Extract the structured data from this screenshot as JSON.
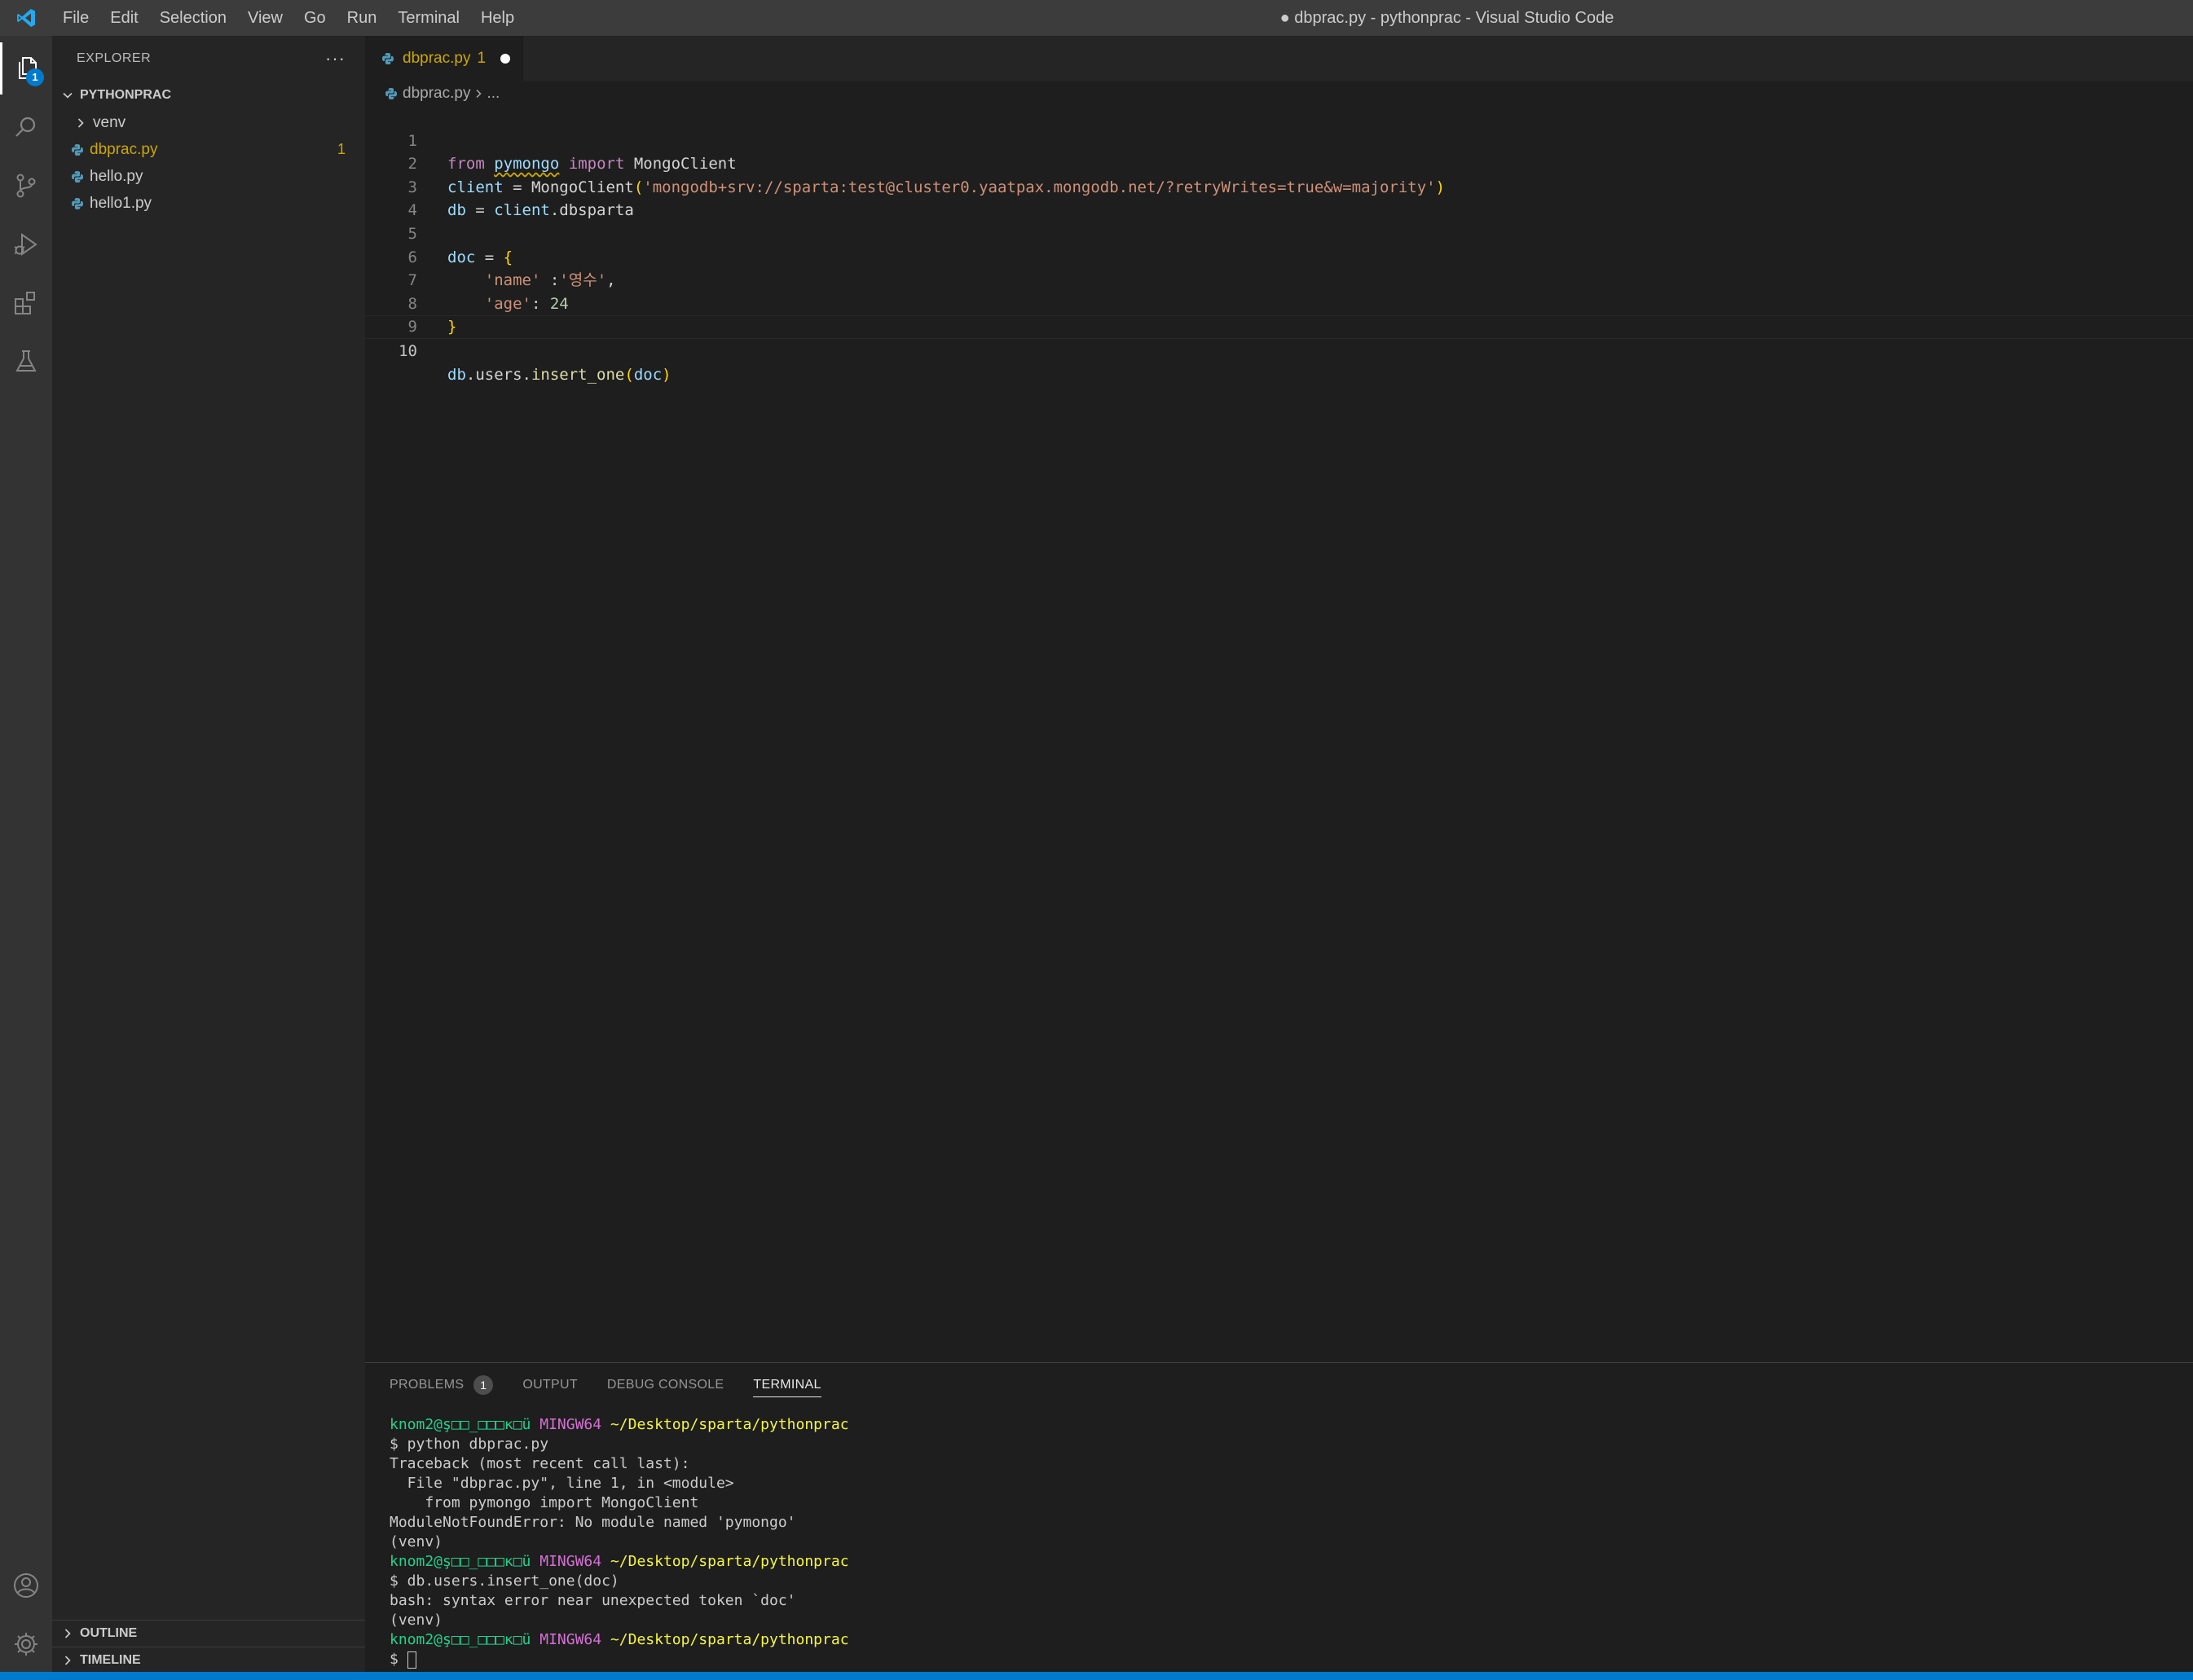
{
  "menu": [
    "File",
    "Edit",
    "Selection",
    "View",
    "Go",
    "Run",
    "Terminal",
    "Help"
  ],
  "window_title": "● dbprac.py - pythonprac - Visual Studio Code",
  "activity": {
    "explorer_badge": "1"
  },
  "sidebar": {
    "title": "EXPLORER",
    "more": "···",
    "folder": "PYTHONPRAC",
    "items": [
      {
        "label": "venv",
        "type": "folder"
      },
      {
        "label": "dbprac.py",
        "type": "file",
        "problems": "1"
      },
      {
        "label": "hello.py",
        "type": "file"
      },
      {
        "label": "hello1.py",
        "type": "file"
      }
    ],
    "outline": "OUTLINE",
    "timeline": "TIMELINE"
  },
  "editor": {
    "tab": {
      "label": "dbprac.py",
      "problems": "1"
    },
    "breadcrumb": {
      "file": "dbprac.py",
      "rest": "..."
    },
    "line_numbers": [
      "1",
      "2",
      "3",
      "4",
      "5",
      "6",
      "7",
      "8",
      "9",
      "10"
    ],
    "code": {
      "l1": {
        "from": "from",
        "module": "pymongo",
        "import": "import",
        "name": "MongoClient"
      },
      "l2": {
        "var": "client",
        "eq": " = ",
        "fn": "MongoClient",
        "open": "(",
        "str": "'mongodb+srv://sparta:test@cluster0.yaatpax.mongodb.net/?retryWrites=true&w=majority'",
        "close": ")"
      },
      "l3": {
        "var": "db",
        "eq": " = ",
        "obj": "client",
        "attr": ".dbsparta"
      },
      "l5": {
        "var": "doc",
        "eq": " = ",
        "open": "{"
      },
      "l6": {
        "indent": "    ",
        "key": "'name'",
        "sep": " :",
        "val": "'영수'",
        "comma": ","
      },
      "l7": {
        "indent": "    ",
        "key": "'age'",
        "sep": ": ",
        "val": "24"
      },
      "l8": {
        "close": "}"
      },
      "l10": {
        "obj": "db",
        "attr": ".users.",
        "fn": "insert_one",
        "open": "(",
        "arg": "doc",
        "close": ")"
      }
    }
  },
  "panel": {
    "tabs": [
      "PROBLEMS",
      "OUTPUT",
      "DEBUG CONSOLE",
      "TERMINAL"
    ],
    "problems_count": "1",
    "terminal": {
      "prompt_user": "knom2@ş□□_□□□κ□ü",
      "prompt_env": "MINGW64",
      "prompt_path": "~/Desktop/sparta/pythonprac",
      "lines": {
        "cmd1": "$ python dbprac.py",
        "tb1": "Traceback (most recent call last):",
        "tb2": "  File \"dbprac.py\", line 1, in <module>",
        "tb3": "    from pymongo import MongoClient",
        "tb4": "ModuleNotFoundError: No module named 'pymongo'",
        "venv": "(venv)",
        "cmd2": "$ db.users.insert_one(doc)",
        "err": "bash: syntax error near unexpected token `doc'",
        "cmd3": "$ "
      }
    }
  },
  "colors": {
    "accent": "#007acc",
    "warning": "#cca700",
    "activity_bar": "#333333",
    "sidebar": "#252526",
    "editor": "#1e1e1e"
  }
}
